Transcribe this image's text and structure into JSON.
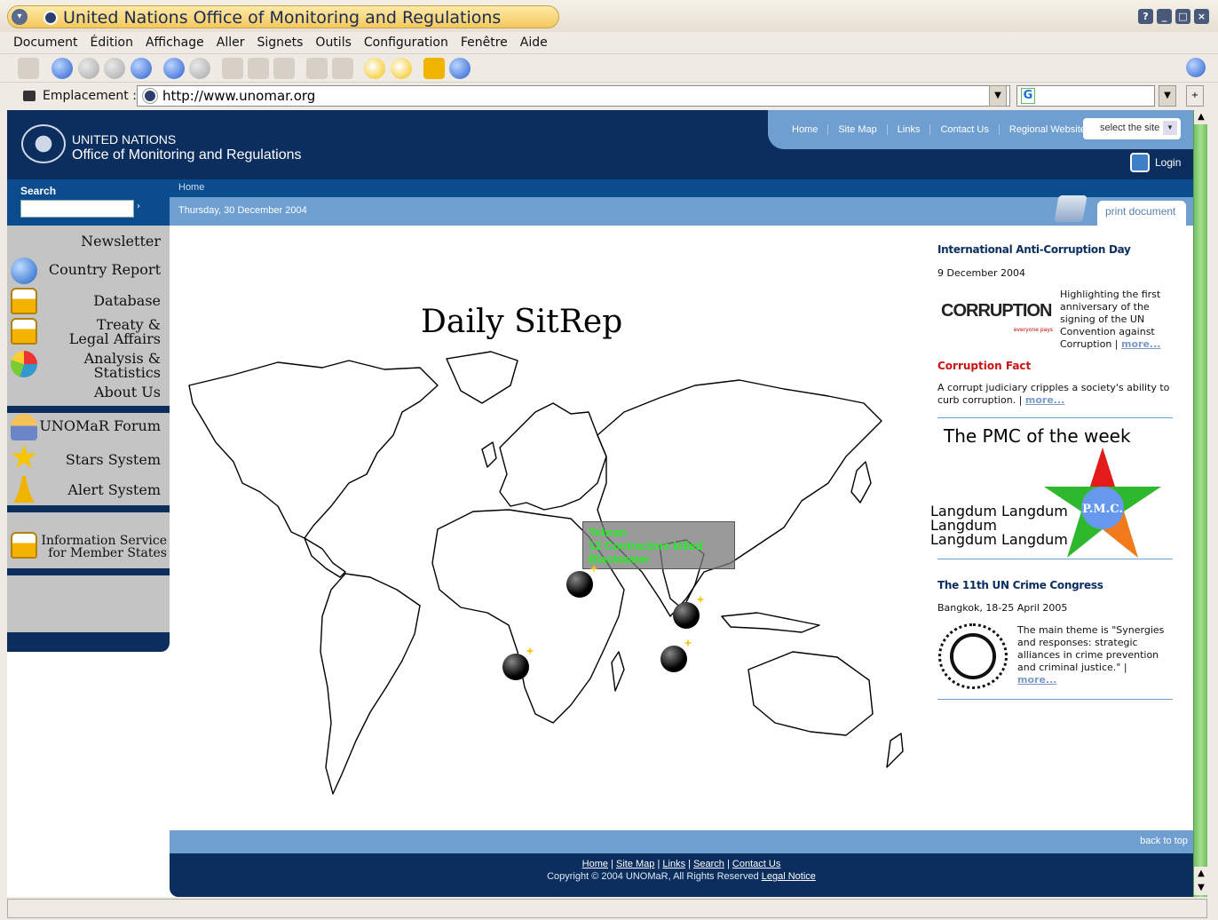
{
  "window": {
    "title": "United Nations Office of Monitoring and Regulations"
  },
  "menu": [
    "Document",
    "Édition",
    "Affichage",
    "Aller",
    "Signets",
    "Outils",
    "Configuration",
    "Fenêtre",
    "Aide"
  ],
  "location": {
    "label": "Emplacement :",
    "url": "http://www.unomar.org"
  },
  "site": {
    "org_name": "UNITED NATIONS",
    "office_name": "Office of Monitoring and Regulations",
    "topnav": [
      "Home",
      "Site Map",
      "Links",
      "Contact Us",
      "Regional Websites"
    ],
    "site_select": "select the site",
    "login": "Login",
    "search_label": "Search",
    "breadcrumb": "Home",
    "date": "Thursday, 30 December 2004",
    "print": "print document"
  },
  "sidebar": {
    "items": [
      {
        "label": "Newsletter",
        "icon": "none"
      },
      {
        "label": "Country Report",
        "icon": "globe-icon"
      },
      {
        "label": "Database",
        "icon": "padlock-icon"
      },
      {
        "label1": "Treaty &",
        "label2": "Legal Affairs",
        "icon": "padlock-icon"
      },
      {
        "label1": "Analysis &",
        "label2": "Statistics",
        "icon": "pie-chart-icon"
      },
      {
        "label": "About Us",
        "icon": "none"
      },
      {
        "label": "UNOMaR Forum",
        "icon": "person-icon"
      },
      {
        "label": "Stars System",
        "icon": "star-icon"
      },
      {
        "label": "Alert System",
        "icon": "bell-icon"
      },
      {
        "label1": "Information Service",
        "label2": "for Member States",
        "icon": "padlock-icon"
      }
    ]
  },
  "main": {
    "title": "Daily SitRep",
    "sitrep_box": [
      "Tehran",
      "12 Contractors killed",
      "Blackwater"
    ]
  },
  "news": {
    "item1": {
      "title": "International Anti-Corruption Day",
      "date": "9 December 2004",
      "logo_text": "CORRUPTION",
      "logo_sub": "everyone pays",
      "body": "Highlighting the first anniversary of the signing of the UN Convention against Corruption",
      "more": "more..."
    },
    "fact": {
      "title": "Corruption Fact",
      "body": "A corrupt judiciary cripples a society's ability to curb corruption.",
      "more": "more..."
    },
    "pmc": {
      "title": "The PMC of the week",
      "badge": "P.M.C.",
      "names": [
        "Langdum Langdum",
        "Langdum",
        "Langdum Langdum"
      ]
    },
    "item2": {
      "title": "The 11th UN Crime Congress",
      "date": "Bangkok, 18-25 April 2005",
      "body": "The main theme is \"Synergies and responses: strategic alliances in crime prevention and criminal justice.\"",
      "more": "more..."
    }
  },
  "footer": {
    "back_to_top": "back to top",
    "links": [
      "Home",
      "Site Map",
      "Links",
      "Search",
      "Contact Us"
    ],
    "copyright": "Copyright © 2004 UNOMaR, All Rights Reserved",
    "legal": "Legal Notice"
  }
}
